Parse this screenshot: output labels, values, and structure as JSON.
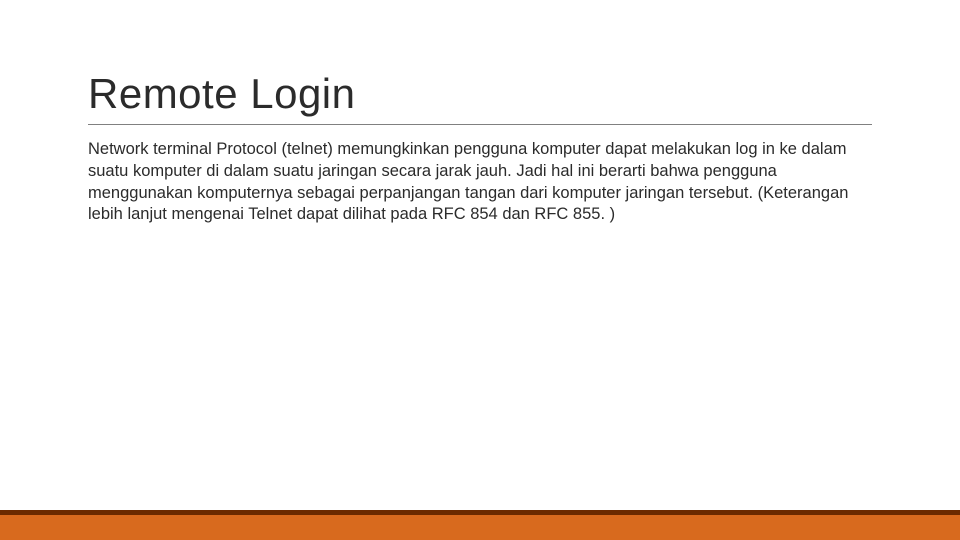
{
  "slide": {
    "title": "Remote Login",
    "body": "Network terminal Protocol (telnet) memungkinkan pengguna komputer dapat melakukan log in ke dalam suatu komputer di dalam suatu jaringan secara jarak jauh. Jadi hal ini berarti bahwa pengguna menggunakan komputernya sebagai perpanjangan tangan dari komputer jaringan tersebut. (Keterangan lebih lanjut mengenai Telnet dapat dilihat pada RFC 854 dan RFC 855. )"
  },
  "colors": {
    "footer_accent_top": "#6b2a00",
    "footer_accent_bottom": "#d86a1e"
  }
}
